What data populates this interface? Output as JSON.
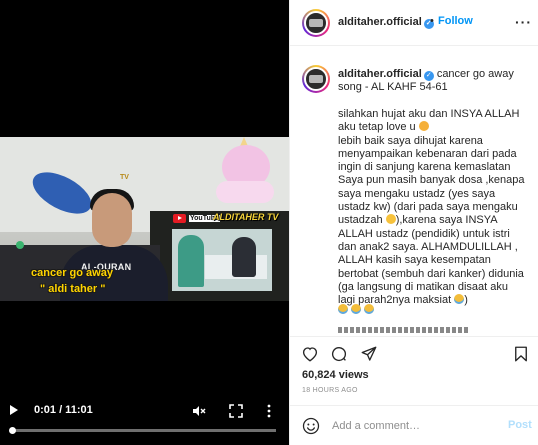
{
  "video": {
    "overlay_tv_tag": "TV",
    "youtube_label": "YouTube",
    "channel_watermark": "ALDITAHER TV",
    "shirt_text": "AL-QURAN",
    "caption_line_1": "cancer go away",
    "caption_line_2": "\" aldi taher \"",
    "controls": {
      "time": "0:01 / 11:01",
      "progress_fraction": 0.0015,
      "icons": [
        "play-icon",
        "mute-icon",
        "fullscreen-icon",
        "more-vert-icon"
      ]
    }
  },
  "post": {
    "header": {
      "username": "alditaher.official",
      "verified_mark": "✓",
      "separator": "•",
      "follow_label": "Follow",
      "options_label": "···"
    },
    "caption": {
      "username": "alditaher.official",
      "title": "cancer go away song - AL KAHF 54-61",
      "body_1": "silahkan hujat aku dan INSYA ALLAH aku tetap love u ",
      "body_2": "\nlebih baik saya dihujat karena menyampaikan kebenaran dari pada ingin di sanjung karena kemaslatan Saya pun masih banyak dosa ,kenapa saya mengaku ustadz (yes saya ustadz kw) (dari pada saya mengaku ustadzah ",
      "body_3": "),karena saya INSYA ALLAH ustadz (pendidik) untuk istri dan anak2 saya. ALHAMDULILLAH , ALLAH kasih saya kesempatan bertobat (sembuh dari kanker) didunia (ga langsung di matikan disaat aku lagi parah2nya maksiat ",
      "body_4": ")",
      "emoji_icons": [
        "smiling-face-with-hearts-icon",
        "sweat-smile-icon",
        "crying-face-icon"
      ]
    },
    "actions": {
      "icons": [
        "heart-icon",
        "comment-icon",
        "share-icon",
        "bookmark-icon"
      ]
    },
    "likes": "60,824 views",
    "timestamp": "18 HOURS AGO",
    "add_comment": {
      "placeholder": "Add a comment…",
      "post_label": "Post"
    }
  },
  "colors": {
    "accent_blue": "#0095f6",
    "post_disabled": "#b2dffc",
    "verified": "#3897f0",
    "caption_yellow": "#ffd400",
    "text_primary": "#262626",
    "text_secondary": "#8e8e8e"
  }
}
